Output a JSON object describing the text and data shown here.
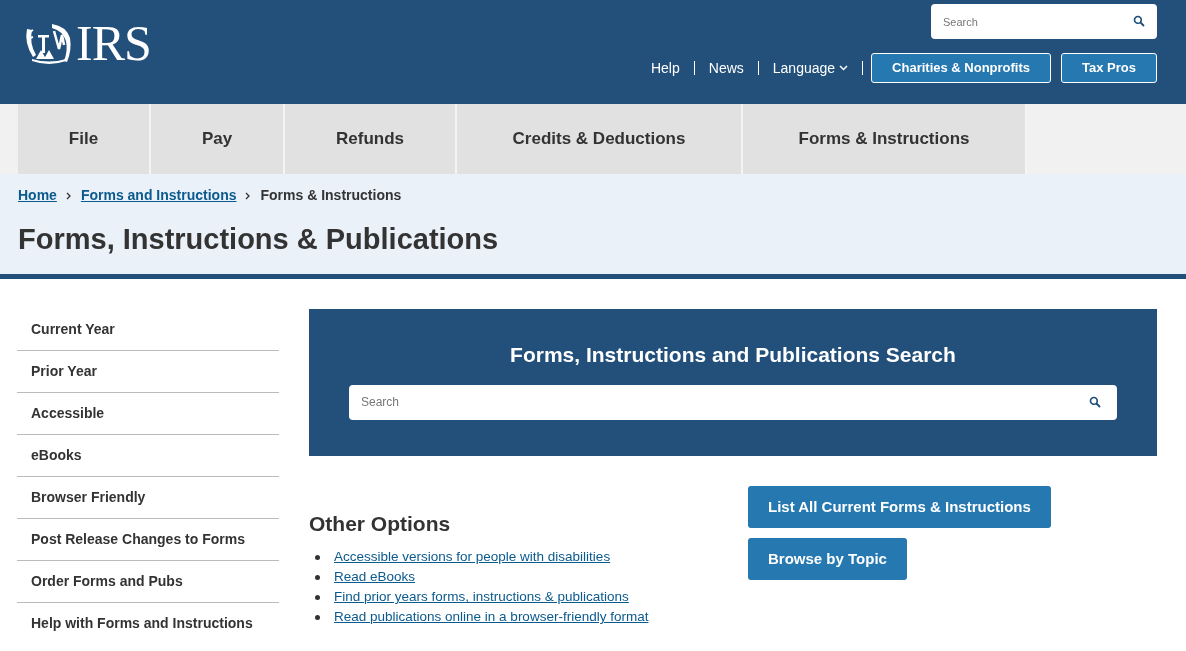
{
  "header": {
    "logo_text": "IRS",
    "search": {
      "placeholder": "Search"
    },
    "links": [
      {
        "label": "Help",
        "dropdown": false
      },
      {
        "label": "News",
        "dropdown": false
      },
      {
        "label": "Language",
        "dropdown": true
      }
    ],
    "buttons": [
      "Charities & Nonprofits",
      "Tax Pros"
    ]
  },
  "nav": [
    "File",
    "Pay",
    "Refunds",
    "Credits & Deductions",
    "Forms & Instructions"
  ],
  "breadcrumb": [
    {
      "label": "Home",
      "link": true
    },
    {
      "label": "Forms and Instructions",
      "link": true
    },
    {
      "label": "Forms & Instructions",
      "link": false
    }
  ],
  "page_title": "Forms, Instructions & Publications",
  "sidebar": {
    "items": [
      "Current Year",
      "Prior Year",
      "Accessible",
      "eBooks",
      "Browser Friendly",
      "Post Release Changes to Forms",
      "Order Forms and Pubs",
      "Help with Forms and Instructions"
    ]
  },
  "search_panel": {
    "title": "Forms, Instructions and Publications Search",
    "placeholder": "Search"
  },
  "other_options": {
    "title": "Other Options",
    "links": [
      "Accessible versions for people with disabilities",
      "Read eBooks",
      "Find prior years forms, instructions & publications",
      "Read publications online in a browser-friendly format"
    ]
  },
  "action_buttons": [
    "List All Current Forms & Instructions",
    "Browse by Topic"
  ]
}
